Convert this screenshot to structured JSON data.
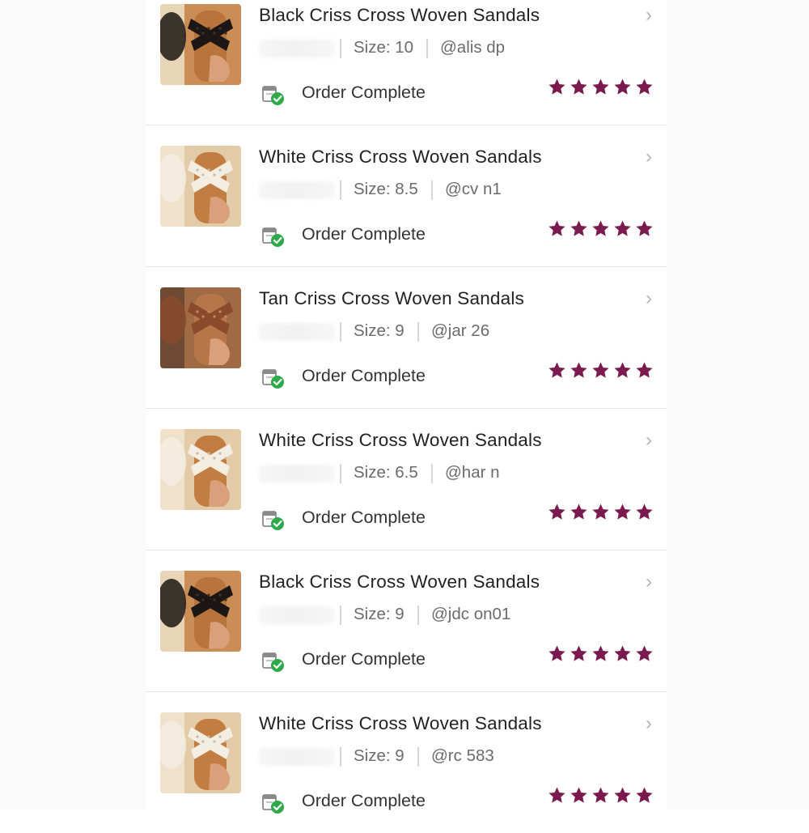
{
  "colors": {
    "star": "#7a1a4e",
    "title": "#222222",
    "meta": "#6b6b6b",
    "check": "#2eaa4a"
  },
  "orders": [
    {
      "title": "Black Criss Cross Woven Sandals",
      "size": "Size: 10",
      "user": "@alis    dp",
      "status": "Order Complete",
      "rating": 5,
      "shoe_color": "black"
    },
    {
      "title": "White Criss Cross Woven Sandals",
      "size": "Size: 8.5",
      "user": "@cv     n1",
      "status": "Order Complete",
      "rating": 5,
      "shoe_color": "white"
    },
    {
      "title": "Tan Criss Cross Woven Sandals",
      "size": "Size: 9",
      "user": "@jar     26",
      "status": "Order Complete",
      "rating": 5,
      "shoe_color": "tan"
    },
    {
      "title": "White Criss Cross Woven Sandals",
      "size": "Size: 6.5",
      "user": "@har    n",
      "status": "Order Complete",
      "rating": 5,
      "shoe_color": "white"
    },
    {
      "title": "Black Criss Cross Woven Sandals",
      "size": "Size: 9",
      "user": "@jdc    on01",
      "status": "Order Complete",
      "rating": 5,
      "shoe_color": "black"
    },
    {
      "title": "White Criss Cross Woven Sandals",
      "size": "Size: 9",
      "user": "@rc     583",
      "status": "Order Complete",
      "rating": 5,
      "shoe_color": "white"
    }
  ]
}
